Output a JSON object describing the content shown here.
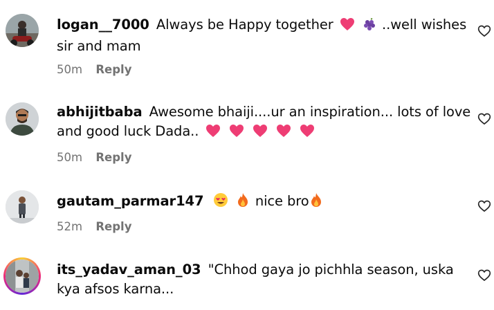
{
  "comments": [
    {
      "username": "logan__7000",
      "text1": "Always be Happy together",
      "text2": "..well wishes sir and mam",
      "time": "50m",
      "reply": "Reply"
    },
    {
      "username": "abhijitbaba",
      "text1": "Awesome bhaiji....ur an inspiration... lots of love and good luck Dada..",
      "time": "50m",
      "reply": "Reply"
    },
    {
      "username": "gautam_parmar147",
      "text1": "nice bro",
      "time": "52m",
      "reply": "Reply"
    },
    {
      "username": "its_yadav_aman_03",
      "text1": "\"Chhod gaya jo pichhla season, uska kya afsos karna..."
    }
  ],
  "icons": {
    "like": "heart-outline-icon",
    "heart_emoji": "pink-heart-emoji",
    "grapes_emoji": "grapes-emoji",
    "heart_eyes_emoji": "heart-eyes-emoji",
    "fire_emoji": "fire-emoji"
  },
  "colors": {
    "meta": "#737373",
    "heart_emoji": "#e8245d"
  }
}
